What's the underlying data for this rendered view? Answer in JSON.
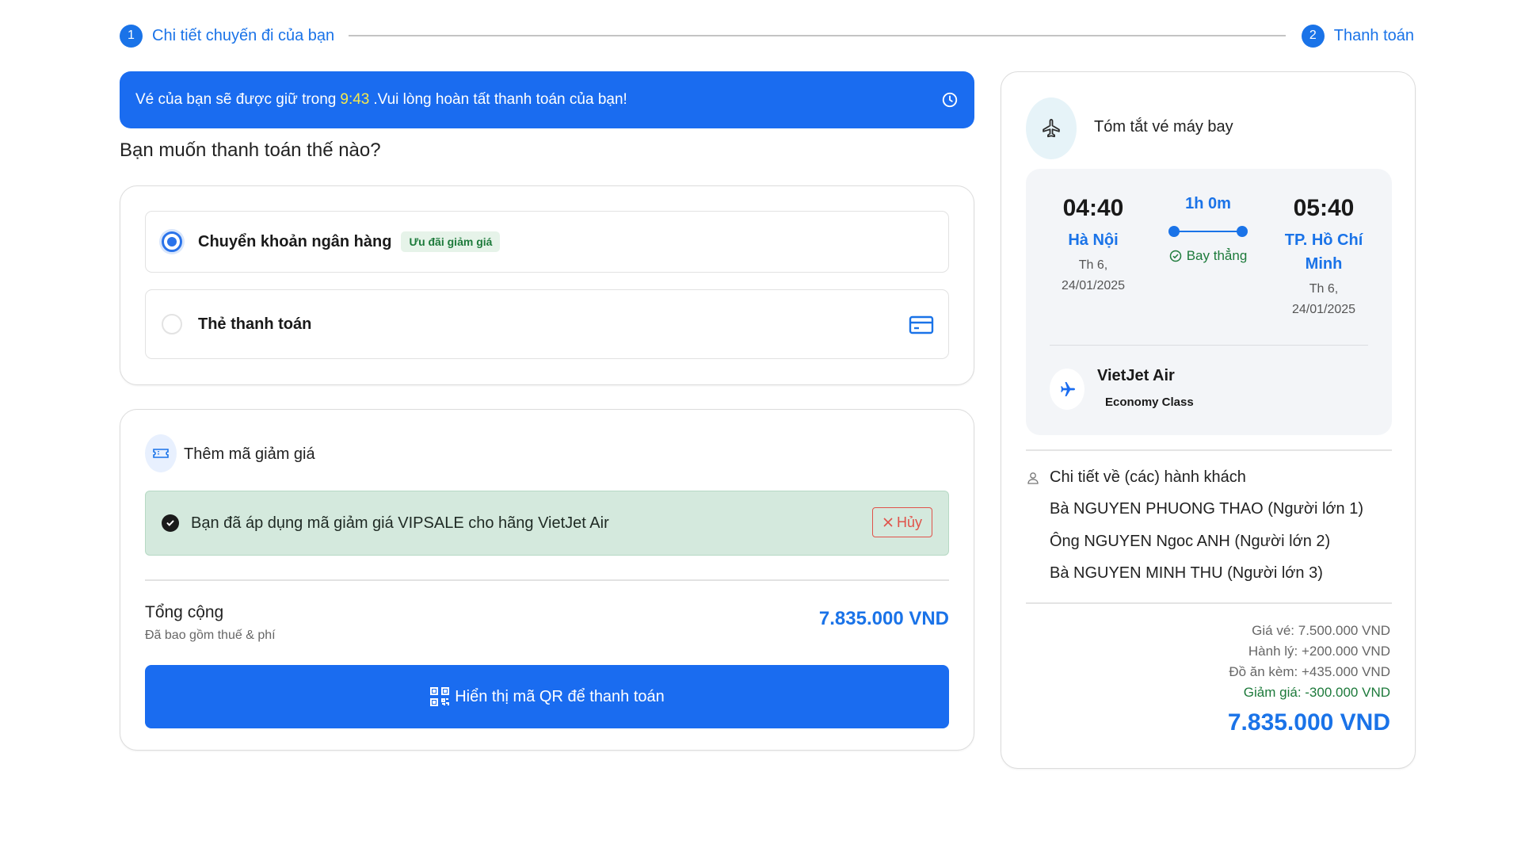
{
  "stepper": {
    "step1_num": "1",
    "step1_label": "Chi tiết chuyến đi của bạn",
    "step2_num": "2",
    "step2_label": "Thanh toán"
  },
  "banner": {
    "prefix": "Vé của bạn sẽ được giữ trong",
    "time": "9:43",
    "suffix": ".Vui lòng hoàn tất thanh toán của bạn!",
    "icon": "clock-icon"
  },
  "payment": {
    "title": "Bạn muốn thanh toán thế nào?",
    "options": [
      {
        "label": "Chuyển khoản ngân hàng",
        "badge": "Ưu đãi giảm giá",
        "selected": true
      },
      {
        "label": "Thẻ thanh toán",
        "icon": "credit-card-icon",
        "selected": false
      }
    ]
  },
  "discount": {
    "title": "Thêm mã giảm giá",
    "applied_message": "Bạn đã áp dụng mã giảm giá VIPSALE cho hãng VietJet Air",
    "cancel_label": "Hủy",
    "total_label": "Tổng cộng",
    "total_sub": "Đã bao gồm thuế & phí",
    "total_value": "7.835.000 VND",
    "qr_button": "Hiển thị mã QR để thanh toán"
  },
  "summary": {
    "title": "Tóm tắt vé máy bay",
    "departure": {
      "time": "04:40",
      "city": "Hà Nội",
      "date": "Th 6, 24/01/2025"
    },
    "arrival": {
      "time": "05:40",
      "city": "TP. Hồ Chí Minh",
      "date": "Th 6, 24/01/2025"
    },
    "duration": "1h 0m",
    "stops": "Bay thẳng",
    "airline": "VietJet Air",
    "cabin": "Economy Class",
    "passengers_title": "Chi tiết về (các) hành khách",
    "passengers": [
      "Bà NGUYEN PHUONG THAO (Người lớn 1)",
      "Ông NGUYEN Ngoc ANH (Người lớn 2)",
      "Bà NGUYEN MINH THU (Người lớn 3)"
    ],
    "fare": "Giá vé: 7.500.000 VND",
    "baggage": "Hành lý: +200.000 VND",
    "meals": "Đồ ăn kèm: +435.000 VND",
    "discount": "Giảm giá: -300.000 VND",
    "grand_total": "7.835.000 VND"
  },
  "colors": {
    "primary": "#1a73e8",
    "banner": "#1a6cf0",
    "timer": "#f7e94b",
    "success": "#1d7a3b",
    "success_bg": "#d4e9dd",
    "danger": "#e0524a"
  }
}
